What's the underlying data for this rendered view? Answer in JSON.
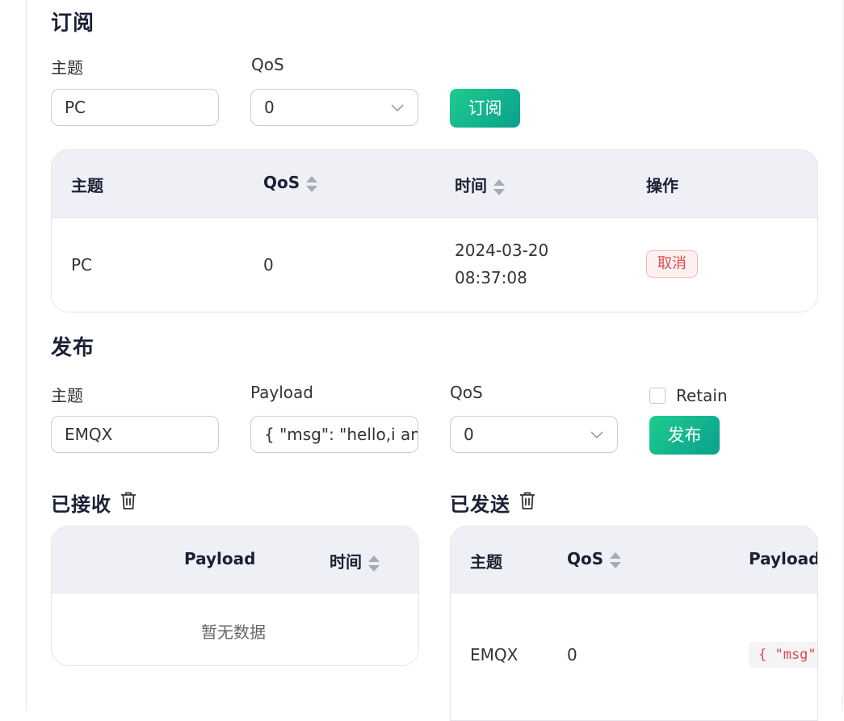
{
  "subscribe": {
    "title": "订阅",
    "topic_label": "主题",
    "topic_value": "PC",
    "qos_label": "QoS",
    "qos_value": "0",
    "button": "订阅",
    "table": {
      "headers": [
        "主题",
        "QoS",
        "时间",
        "操作"
      ],
      "rows": [
        {
          "topic": "PC",
          "qos": "0",
          "date": "2024-03-20",
          "time": "08:37:08",
          "action": "取消"
        }
      ]
    }
  },
  "publish": {
    "title": "发布",
    "topic_label": "主题",
    "topic_value": "EMQX",
    "payload_label": "Payload",
    "payload_value": "{ \"msg\": \"hello,i am",
    "qos_label": "QoS",
    "qos_value": "0",
    "retain_label": "Retain",
    "retain_checked": false,
    "button": "发布"
  },
  "received": {
    "title": "已接收",
    "headers": [
      "Payload",
      "时间"
    ],
    "empty_text": "暂无数据"
  },
  "sent": {
    "title": "已发送",
    "headers": [
      "主题",
      "QoS",
      "Payload"
    ],
    "rows": [
      {
        "topic": "EMQX",
        "qos": "0",
        "payload": "{ \"msg\":"
      }
    ]
  },
  "colors": {
    "accent": "#1fcc8c",
    "danger": "#e0474f",
    "header_bg": "#eef0f5"
  }
}
